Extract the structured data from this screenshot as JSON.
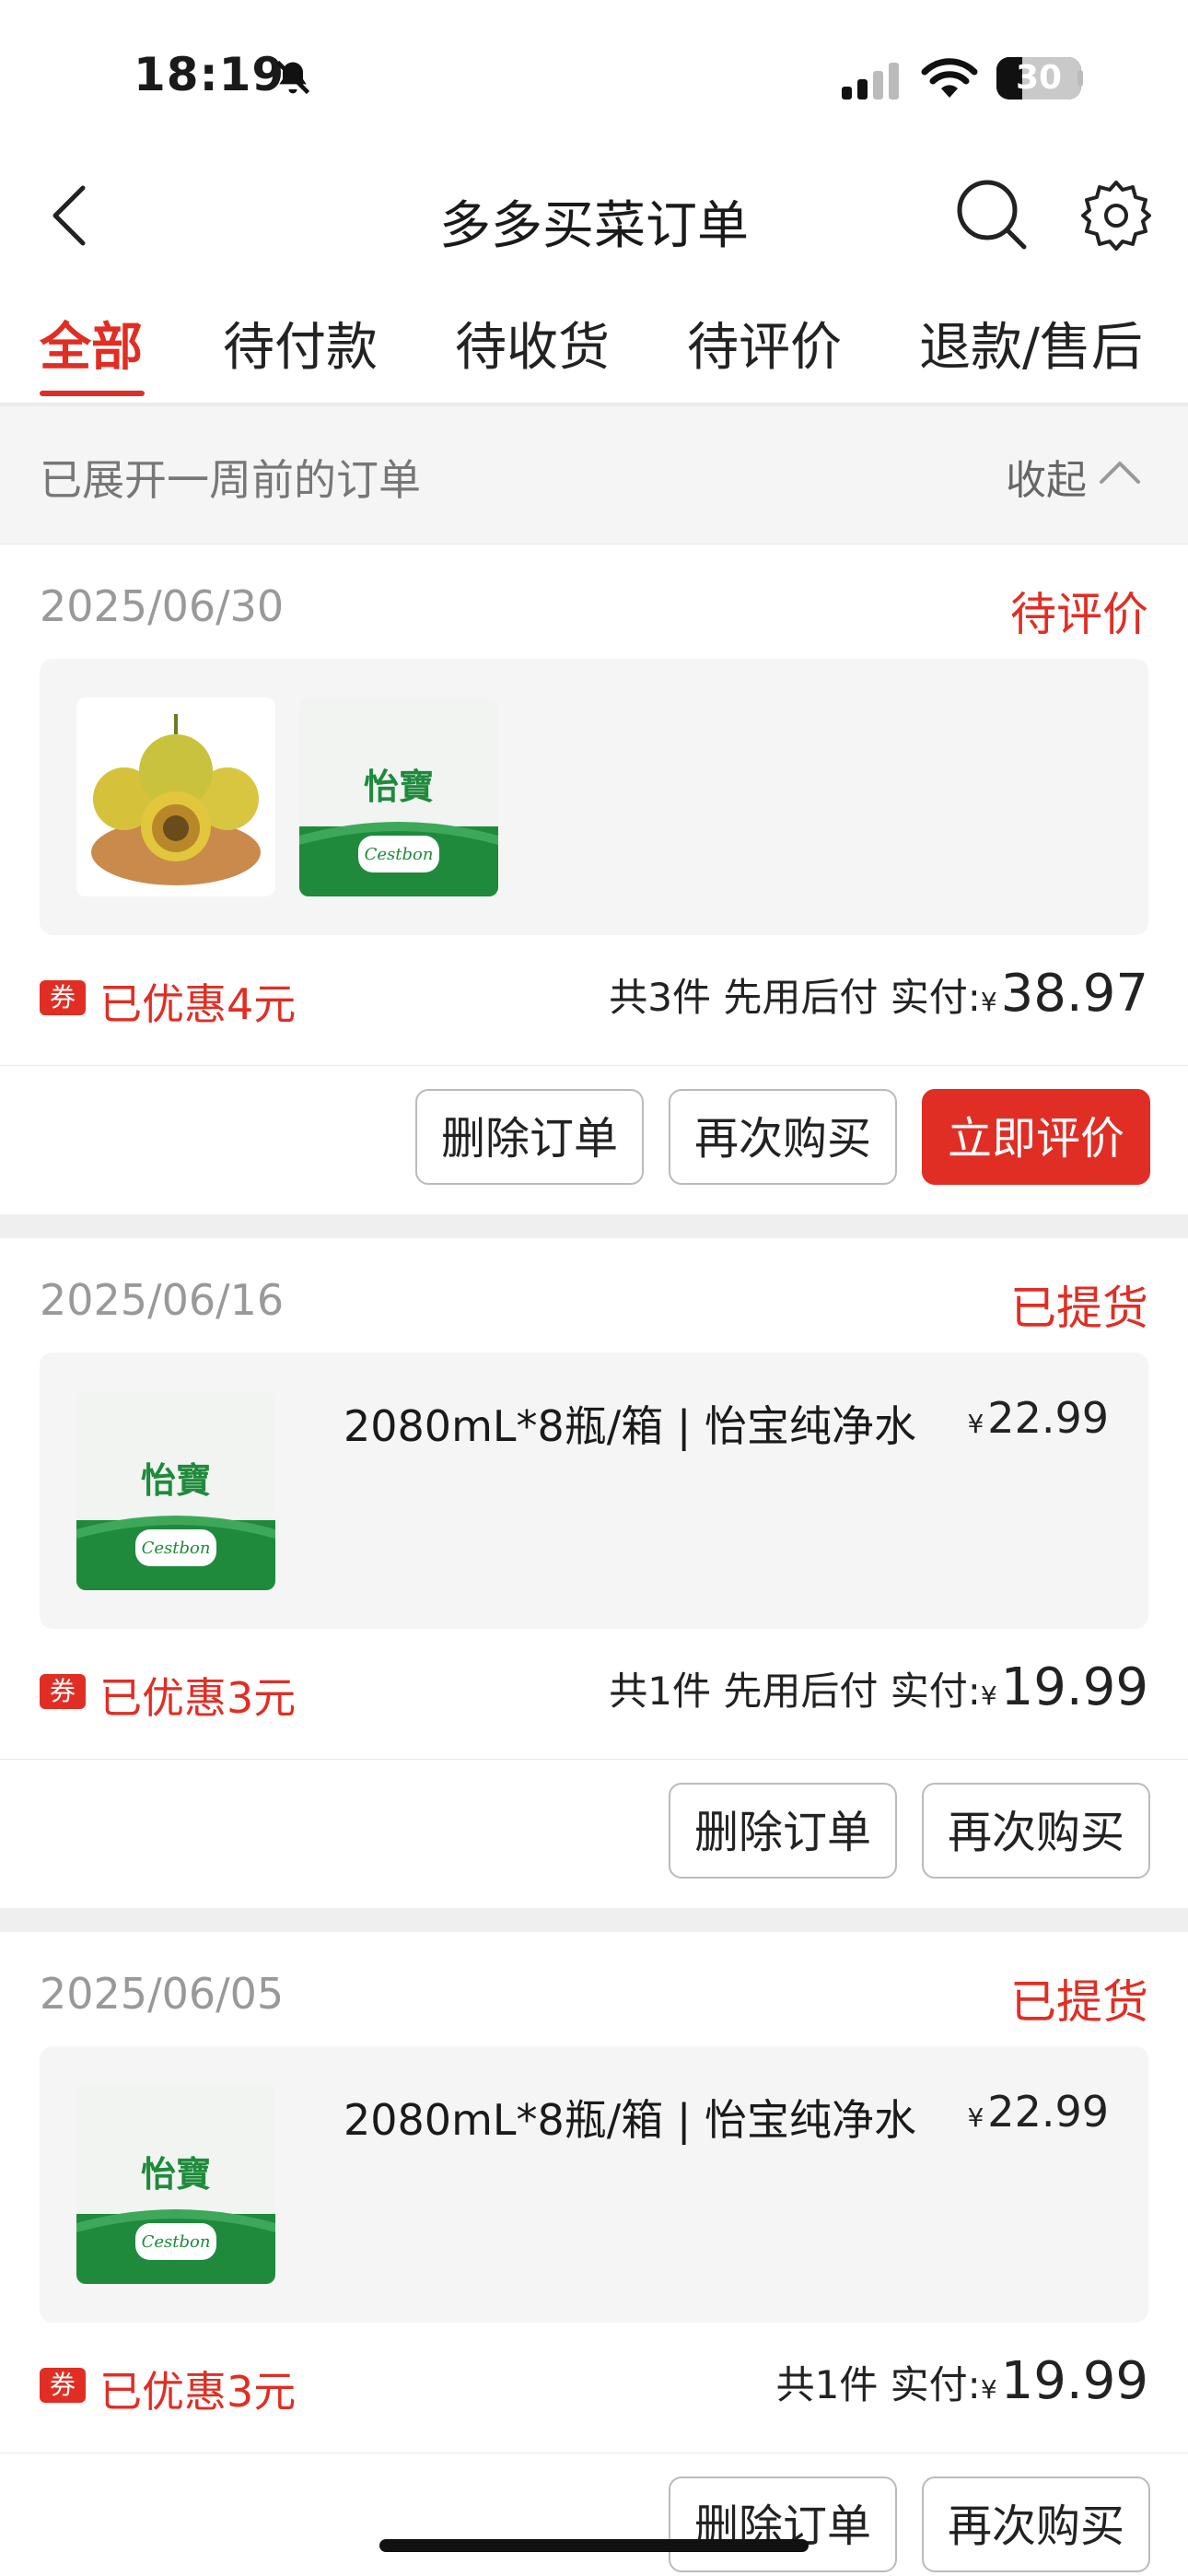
{
  "status_bar": {
    "time": "18:19",
    "battery": "30"
  },
  "header": {
    "title": "多多买菜订单"
  },
  "tabs": [
    "全部",
    "待付款",
    "待收货",
    "待评价",
    "退款/售后"
  ],
  "expanded_bar": {
    "text": "已展开一周前的订单",
    "collapse_label": "收起"
  },
  "orders": [
    {
      "date": "2025/06/30",
      "status": "待评价",
      "coupon_icon": "券",
      "discount": "已优惠4元",
      "summary_prefix": "共3件 先用后付 实付:",
      "currency": "¥",
      "amount": "38.97",
      "buttons": [
        "删除订单",
        "再次购买",
        "立即评价"
      ]
    },
    {
      "date": "2025/06/16",
      "status": "已提货",
      "product_name": "2080mL*8瓶/箱 | 怡宝纯净水",
      "product_price": "22.99",
      "coupon_icon": "券",
      "discount": "已优惠3元",
      "summary_prefix": "共1件 先用后付 实付:",
      "currency": "¥",
      "amount": "19.99",
      "buttons": [
        "删除订单",
        "再次购买"
      ]
    },
    {
      "date": "2025/06/05",
      "status": "已提货",
      "product_name": "2080mL*8瓶/箱 | 怡宝纯净水",
      "product_price": "22.99",
      "coupon_icon": "券",
      "discount": "已优惠3元",
      "summary_prefix": "共1件 实付:",
      "currency": "¥",
      "amount": "19.99",
      "buttons": [
        "删除订单",
        "再次购买"
      ]
    }
  ],
  "product_logos": {
    "water_brand_cn": "怡寶",
    "water_brand_en": "Cestbon"
  },
  "colors": {
    "accent": "#e02e24",
    "product_green": "#1f8a3c"
  }
}
